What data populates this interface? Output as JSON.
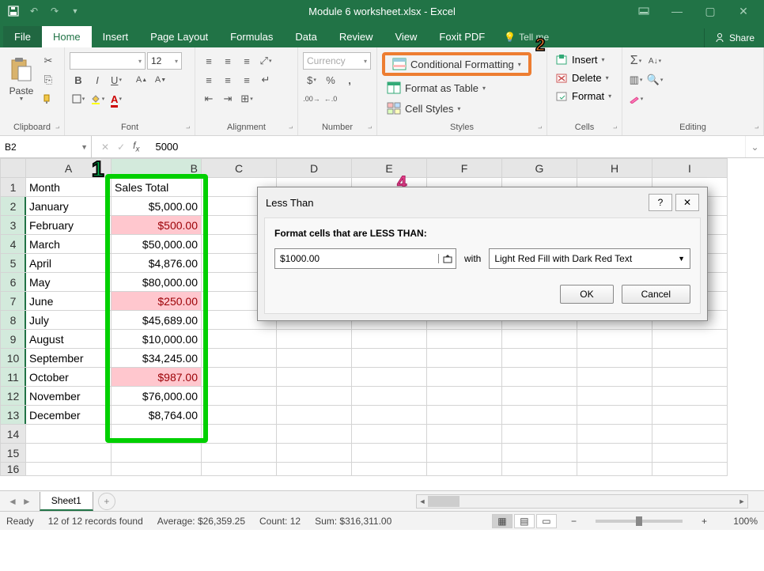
{
  "title": "Module 6 worksheet.xlsx - Excel",
  "tabs": {
    "file": "File",
    "home": "Home",
    "insert": "Insert",
    "pagelayout": "Page Layout",
    "formulas": "Formulas",
    "data": "Data",
    "review": "Review",
    "view": "View",
    "foxit": "Foxit PDF",
    "tellme": "Tell me",
    "share": "Share"
  },
  "ribbon": {
    "clipboard": {
      "paste": "Paste",
      "label": "Clipboard"
    },
    "font": {
      "size": "12",
      "label": "Font"
    },
    "alignment": {
      "label": "Alignment"
    },
    "number": {
      "format": "Currency",
      "label": "Number"
    },
    "styles": {
      "cond": "Conditional Formatting",
      "table": "Format as Table",
      "cell": "Cell Styles",
      "label": "Styles"
    },
    "cells": {
      "insert": "Insert",
      "delete": "Delete",
      "format": "Format",
      "label": "Cells"
    },
    "editing": {
      "label": "Editing"
    }
  },
  "namebox": "B2",
  "formula": "5000",
  "columns": [
    "A",
    "B",
    "C",
    "D",
    "E",
    "F",
    "G",
    "H",
    "I"
  ],
  "headers": {
    "A": "Month",
    "B": "Sales Total"
  },
  "rows": [
    {
      "n": 1,
      "A": "Month",
      "B": "Sales Total",
      "hdr": true
    },
    {
      "n": 2,
      "A": "January",
      "B": "$5,000.00"
    },
    {
      "n": 3,
      "A": "February",
      "B": "$500.00",
      "red": true
    },
    {
      "n": 4,
      "A": "March",
      "B": "$50,000.00"
    },
    {
      "n": 5,
      "A": "April",
      "B": "$4,876.00"
    },
    {
      "n": 6,
      "A": "May",
      "B": "$80,000.00"
    },
    {
      "n": 7,
      "A": "June",
      "B": "$250.00",
      "red": true
    },
    {
      "n": 8,
      "A": "July",
      "B": "$45,689.00"
    },
    {
      "n": 9,
      "A": "August",
      "B": "$10,000.00"
    },
    {
      "n": 10,
      "A": "September",
      "B": "$34,245.00"
    },
    {
      "n": 11,
      "A": "October",
      "B": "$987.00",
      "red": true
    },
    {
      "n": 12,
      "A": "November",
      "B": "$76,000.00"
    },
    {
      "n": 13,
      "A": "December",
      "B": "$8,764.00"
    },
    {
      "n": 14,
      "A": "",
      "B": ""
    },
    {
      "n": 15,
      "A": "",
      "B": ""
    }
  ],
  "dialog": {
    "title": "Less Than",
    "label": "Format cells that are LESS THAN:",
    "value": "$1000.00",
    "with": "with",
    "format": "Light Red Fill with Dark Red Text",
    "ok": "OK",
    "cancel": "Cancel"
  },
  "sheet": {
    "name": "Sheet1"
  },
  "status": {
    "ready": "Ready",
    "records": "12 of 12 records found",
    "avg_label": "Average:",
    "avg": "$26,359.25",
    "count_label": "Count:",
    "count": "12",
    "sum_label": "Sum:",
    "sum": "$316,311.00",
    "zoom": "100%"
  },
  "annotations": {
    "n1": "1",
    "n2": "2",
    "n4": "4"
  }
}
